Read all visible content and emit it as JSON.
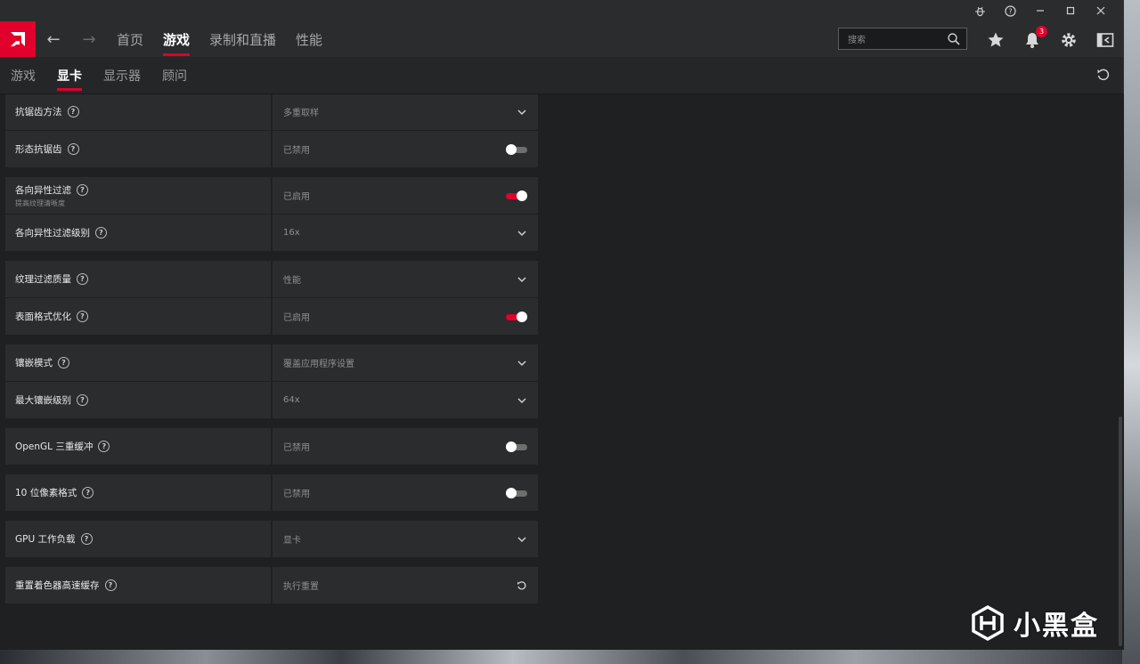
{
  "accent": "#e0002b",
  "titlebar": {
    "icons": [
      "bug-icon",
      "help-icon",
      "minimize-icon",
      "maximize-icon",
      "close-icon"
    ]
  },
  "topnav": {
    "items": [
      {
        "label": "首页",
        "active": false
      },
      {
        "label": "游戏",
        "active": true
      },
      {
        "label": "录制和直播",
        "active": false
      },
      {
        "label": "性能",
        "active": false
      }
    ],
    "search_placeholder": "搜索",
    "notification_count": "3"
  },
  "subnav": {
    "items": [
      {
        "label": "游戏",
        "active": false
      },
      {
        "label": "显卡",
        "active": true
      },
      {
        "label": "显示器",
        "active": false
      },
      {
        "label": "顾问",
        "active": false
      }
    ]
  },
  "settings": [
    {
      "label": "抗锯齿方法",
      "value": "多重取样",
      "control": "dropdown"
    },
    {
      "label": "形态抗锯齿",
      "value": "已禁用",
      "control": "toggle",
      "on": false
    },
    {
      "label": "各向异性过滤",
      "sublabel": "提高纹理清晰度",
      "value": "已启用",
      "control": "toggle",
      "on": true
    },
    {
      "label": "各向异性过滤级别",
      "value": "16x",
      "control": "dropdown"
    },
    {
      "label": "纹理过滤质量",
      "value": "性能",
      "control": "dropdown"
    },
    {
      "label": "表面格式优化",
      "value": "已启用",
      "control": "toggle",
      "on": true
    },
    {
      "label": "镶嵌模式",
      "value": "覆盖应用程序设置",
      "control": "dropdown"
    },
    {
      "label": "最大镶嵌级别",
      "value": "64x",
      "control": "dropdown"
    },
    {
      "label": "OpenGL 三重缓冲",
      "value": "已禁用",
      "control": "toggle",
      "on": false
    },
    {
      "label": "10 位像素格式",
      "value": "已禁用",
      "control": "toggle",
      "on": false
    },
    {
      "label": "GPU 工作负载",
      "value": "显卡",
      "control": "dropdown"
    },
    {
      "label": "重置着色器高速缓存",
      "value": "执行重置",
      "control": "reset"
    }
  ],
  "watermark": "小黑盒"
}
